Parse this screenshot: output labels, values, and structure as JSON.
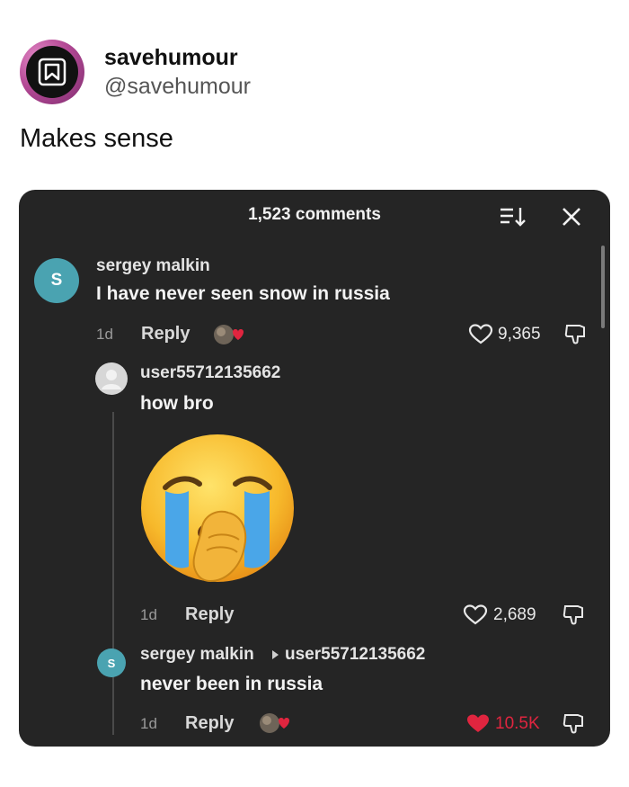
{
  "post": {
    "author_name": "savehumour",
    "author_handle": "@savehumour",
    "text": "Makes sense"
  },
  "comments_panel": {
    "title": "1,523 comments",
    "comments": [
      {
        "avatar_letter": "S",
        "username": "sergey malkin",
        "text": "I have never seen snow in russia",
        "time": "1d",
        "reply_label": "Reply",
        "likes": "9,365"
      },
      {
        "username": "user55712135662",
        "text": "how bro",
        "sticker": "crying-face-emoji",
        "time": "1d",
        "reply_label": "Reply",
        "likes": "2,689"
      },
      {
        "avatar_letter": "S",
        "username": "sergey malkin",
        "reply_to": "user55712135662",
        "text": "never been in russia",
        "time": "1d",
        "reply_label": "Reply",
        "likes": "10.5K"
      }
    ]
  },
  "colors": {
    "panel_bg": "#252525",
    "avatar_teal": "#4aa3b1",
    "liked_red": "#e0253f"
  }
}
